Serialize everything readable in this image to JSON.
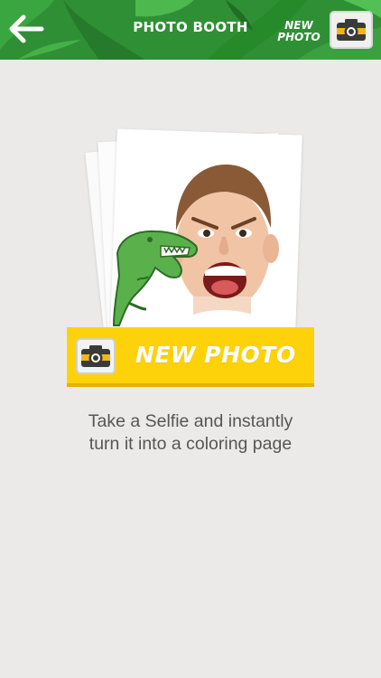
{
  "header": {
    "title": "PHOTO BOOTH",
    "new_photo_line1": "NEW",
    "new_photo_line2": "PHOTO",
    "back_icon": "arrow-left-icon",
    "camera_icon": "camera-icon"
  },
  "main": {
    "button_label": "NEW PHOTO",
    "button_icon": "camera-icon",
    "caption_line1": "Take a Selfie and instantly",
    "caption_line2": "turn it into a coloring page"
  },
  "colors": {
    "header_green": "#2f8f34",
    "button_yellow": "#fdd20a",
    "background": "#ebeae8",
    "camera_body": "#3a3a3a",
    "camera_stripe": "#f3b51b"
  }
}
